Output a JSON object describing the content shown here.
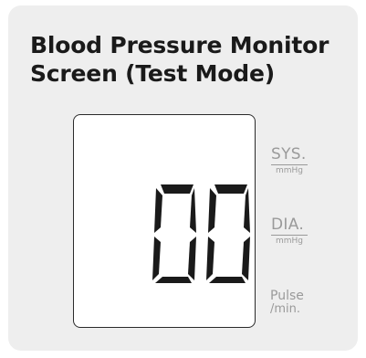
{
  "title": {
    "line1": "Blood Pressure Monitor",
    "line2": "Screen (Test Mode)"
  },
  "display": {
    "reading": "00",
    "sys_label": "SYS.",
    "sys_unit": "mmHg",
    "dia_label": "DIA.",
    "dia_unit": "mmHg",
    "pulse_label": "Pulse",
    "pulse_unit": "/min."
  },
  "colors": {
    "card_background": "#eeeeee",
    "segment": "#1a1a1a",
    "label_gray": "#9a9a9a"
  }
}
